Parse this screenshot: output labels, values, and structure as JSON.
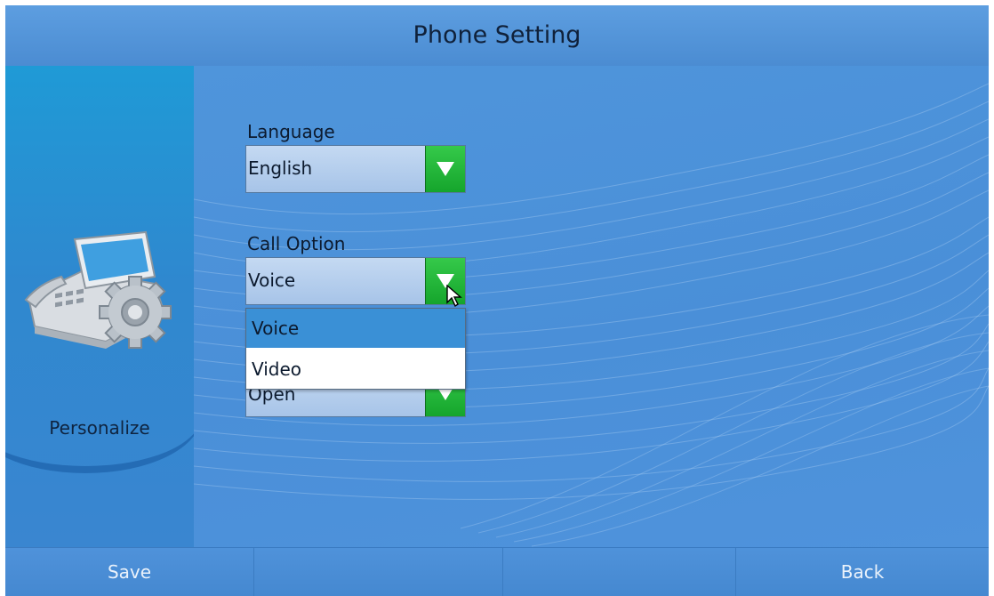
{
  "header": {
    "title": "Phone Setting"
  },
  "sidebar": {
    "label": "Personalize",
    "icon": "phone-settings-icon"
  },
  "fields": [
    {
      "label": "Language",
      "value": "English"
    },
    {
      "label": "Call Option",
      "value": "Voice"
    },
    {
      "label": "",
      "value": "Open"
    }
  ],
  "dropdown": {
    "options": [
      "Voice",
      "Video"
    ],
    "highlighted": "Voice"
  },
  "softkeys": [
    "Save",
    "",
    "",
    "Back"
  ],
  "colors": {
    "background": "#4b90d8",
    "accent_green": "#1fb337",
    "highlight": "#3a90d6"
  }
}
